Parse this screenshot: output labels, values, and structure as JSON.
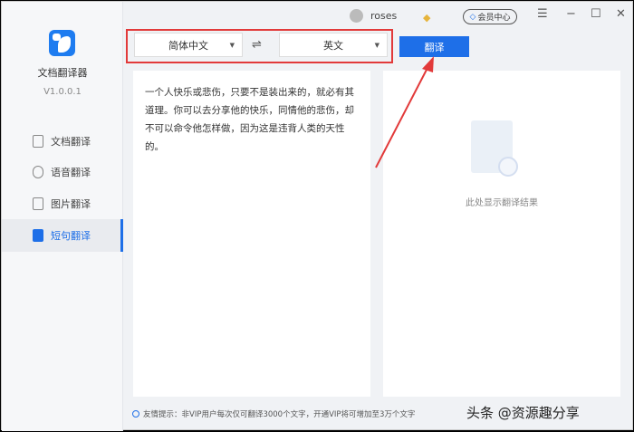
{
  "app": {
    "name": "文档翻译器",
    "version": "V1.0.0.1",
    "logo": "bird-translate-logo"
  },
  "sidebar": {
    "items": [
      {
        "label": "文档翻译",
        "icon": "document-icon"
      },
      {
        "label": "语音翻译",
        "icon": "microphone-icon"
      },
      {
        "label": "图片翻译",
        "icon": "image-icon"
      },
      {
        "label": "短句翻译",
        "icon": "sentence-icon",
        "active": true
      }
    ]
  },
  "topbar": {
    "username": "roses",
    "vip_label": "会员中心"
  },
  "toolbar": {
    "source_lang": "简体中文",
    "target_lang": "英文",
    "translate_label": "翻译"
  },
  "source_text": "一个人快乐或悲伤，只要不是装出来的，就必有其道理。你可以去分享他的快乐，同情他的悲伤，却不可以命令他怎样做，因为这是违背人类的天性的。",
  "result_placeholder": "此处显示翻译结果",
  "hint": "友情提示：非VIP用户每次仅可翻译3000个文字，开通VIP将可增加至3万个文字",
  "watermark": "头条 @资源趣分享",
  "colors": {
    "accent": "#1e6fe8",
    "annotation": "#e23a3a"
  }
}
